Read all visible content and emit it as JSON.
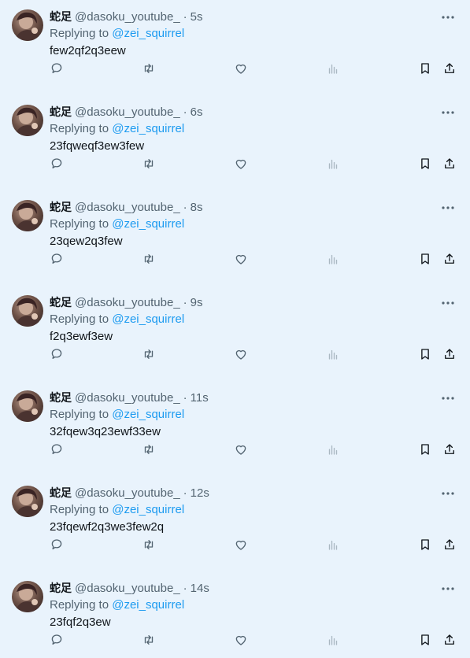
{
  "colors": {
    "background": "#e9f3fc",
    "primary_text": "#0f1419",
    "secondary_text": "#536471",
    "link": "#1d9bf0",
    "icon": "#536471",
    "views_icon": "#aab8c2"
  },
  "icons": {
    "more": "more-horizontal-icon",
    "reply": "reply-bubble-icon",
    "retweet": "retweet-icon",
    "like": "heart-icon",
    "views": "analytics-bars-icon",
    "bookmark": "bookmark-icon",
    "share": "share-upload-icon"
  },
  "tweets": [
    {
      "name": "蛇足",
      "handle": "@dasoku_youtube_",
      "separator": "·",
      "time": "5s",
      "replying_prefix": "Replying to",
      "replying_to": "@zei_squirrel",
      "text": "few2qf2q3eew"
    },
    {
      "name": "蛇足",
      "handle": "@dasoku_youtube_",
      "separator": "·",
      "time": "6s",
      "replying_prefix": "Replying to",
      "replying_to": "@zei_squirrel",
      "text": "23fqweqf3ew3few"
    },
    {
      "name": "蛇足",
      "handle": "@dasoku_youtube_",
      "separator": "·",
      "time": "8s",
      "replying_prefix": "Replying to",
      "replying_to": "@zei_squirrel",
      "text": "23qew2q3few"
    },
    {
      "name": "蛇足",
      "handle": "@dasoku_youtube_",
      "separator": "·",
      "time": "9s",
      "replying_prefix": "Replying to",
      "replying_to": "@zei_squirrel",
      "text": "f2q3ewf3ew"
    },
    {
      "name": "蛇足",
      "handle": "@dasoku_youtube_",
      "separator": "·",
      "time": "11s",
      "replying_prefix": "Replying to",
      "replying_to": "@zei_squirrel",
      "text": "32fqew3q23ewf33ew"
    },
    {
      "name": "蛇足",
      "handle": "@dasoku_youtube_",
      "separator": "·",
      "time": "12s",
      "replying_prefix": "Replying to",
      "replying_to": "@zei_squirrel",
      "text": "23fqewf2q3we3few2q"
    },
    {
      "name": "蛇足",
      "handle": "@dasoku_youtube_",
      "separator": "·",
      "time": "14s",
      "replying_prefix": "Replying to",
      "replying_to": "@zei_squirrel",
      "text": "23fqf2q3ew"
    }
  ]
}
